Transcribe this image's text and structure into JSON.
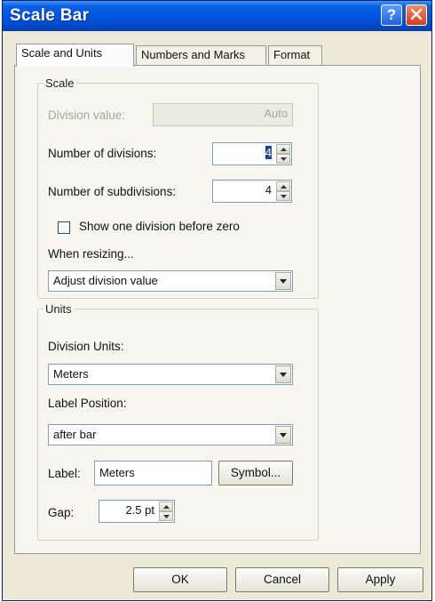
{
  "window": {
    "title": "Scale Bar"
  },
  "titlebar_buttons": {
    "help_glyph": "?",
    "close_icon": "close-icon"
  },
  "tabs": [
    {
      "label": "Scale and Units"
    },
    {
      "label": "Numbers and Marks"
    },
    {
      "label": "Format"
    }
  ],
  "scale_group": {
    "legend": "Scale",
    "division_value": {
      "label": "Division value:",
      "value": "Auto"
    },
    "num_divisions": {
      "label": "Number of divisions:",
      "value": "4"
    },
    "num_subdivisions": {
      "label": "Number of subdivisions:",
      "value": "4"
    },
    "show_one_division": {
      "label": "Show one division before zero",
      "checked": false
    },
    "when_resizing": {
      "label": "When resizing...",
      "value": "Adjust division value"
    }
  },
  "units_group": {
    "legend": "Units",
    "division_units": {
      "label": "Division Units:",
      "value": "Meters"
    },
    "label_position": {
      "label": "Label Position:",
      "value": "after bar"
    },
    "label_field": {
      "label": "Label:",
      "value": "Meters"
    },
    "symbol_button": "Symbol...",
    "gap": {
      "label": "Gap:",
      "value": "2.5 pt"
    }
  },
  "footer": {
    "ok": "OK",
    "cancel": "Cancel",
    "apply": "Apply"
  },
  "colors": {
    "titlebar": "#0055e5",
    "dialog_bg": "#ece9d8",
    "panel_bg": "#f6f5ee"
  }
}
